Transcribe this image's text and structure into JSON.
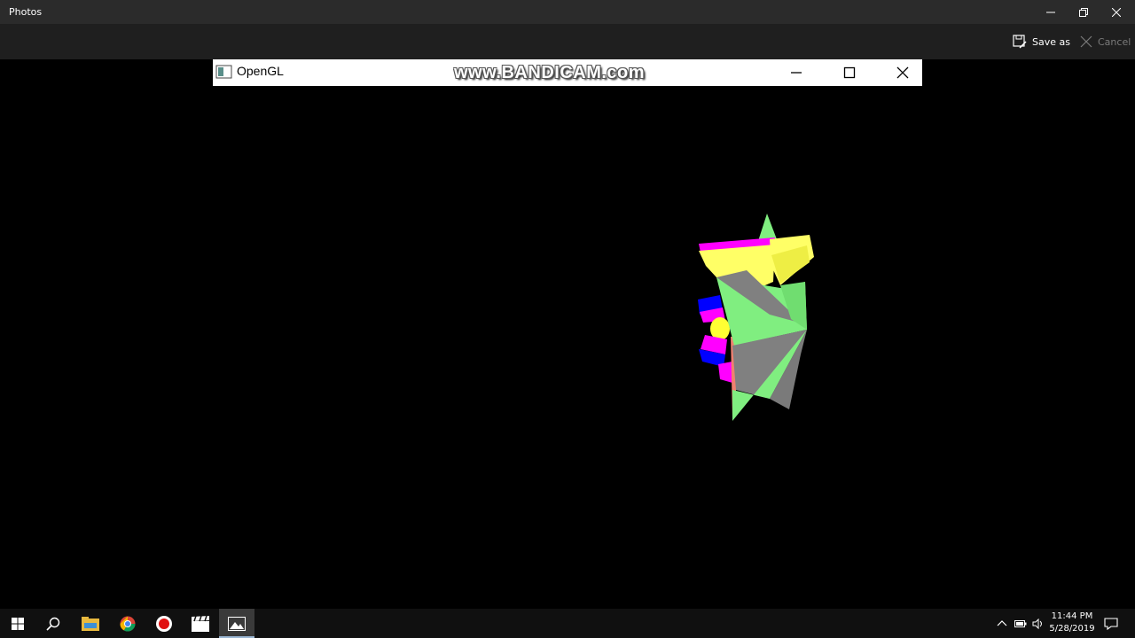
{
  "window": {
    "title": "Photos"
  },
  "toolbar": {
    "save_as_label": "Save as",
    "cancel_label": "Cancel"
  },
  "opengl_window": {
    "title": "OpenGL",
    "watermark": "www.BANDICAM.com"
  },
  "scene_colors": {
    "yellow": "#ffff66",
    "magenta": "#ff00ff",
    "green": "#80ee80",
    "gray": "#808080",
    "blue": "#0000ff",
    "salmon": "#f08070"
  },
  "taskbar": {
    "icons": [
      "windows-start-icon",
      "search-icon",
      "file-explorer-icon",
      "chrome-icon",
      "record-icon",
      "video-editor-icon",
      "photos-icon"
    ],
    "time": "11:44 PM",
    "date": "5/28/2019"
  }
}
